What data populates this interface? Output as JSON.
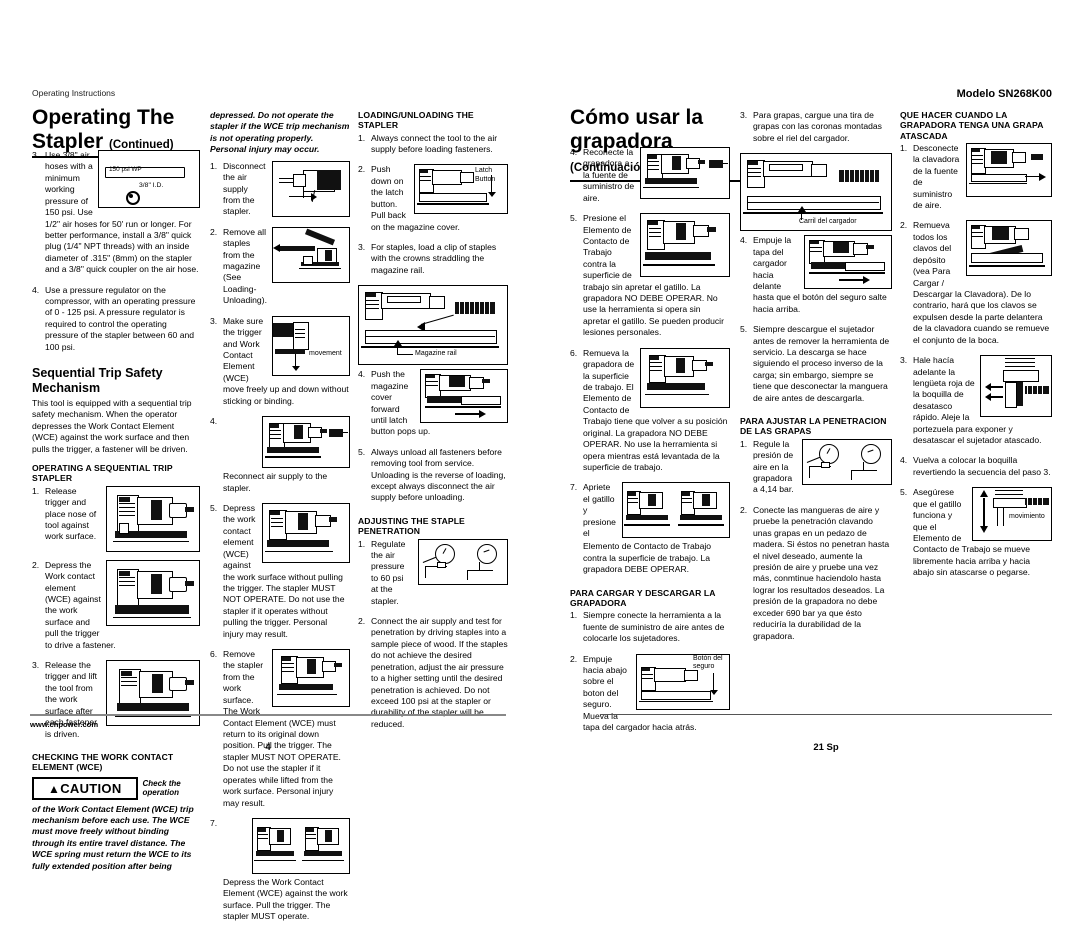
{
  "meta": {
    "header_left": "Operating Instructions",
    "header_right_model": "Modelo SN268K00",
    "footer_url": "www.chpower.com",
    "page_left": "4",
    "page_right": "21 Sp"
  },
  "left_page": {
    "title_main": "Operating The",
    "title_sub": "Stapler",
    "title_cont": "(Continued)",
    "col1": {
      "item3": {
        "num": "3.",
        "text": "Use 3/8\" air hoses with a minimum working pressure of 150 psi. Use 1/2\" air hoses for 50' run or longer. For better performance, install a 3/8\" quick plug (1/4\" NPT threads) with an inside diameter of .315\" (8mm) on the stapler and a 3/8\" quick coupler on the air hose.",
        "fig_label_psi": "150 psi WP",
        "fig_label_id": "3/8\" I.D."
      },
      "item4": {
        "num": "4.",
        "text": "Use a pressure regulator on the compressor, with an operating pressure of 0 - 125 psi. A pressure regulator is required to control the operating pressure of the stapler between 60 and 100 psi."
      },
      "heading_seq": "Sequential Trip Safety Mechanism",
      "seq_body": "This tool is equipped with a sequential trip safety mechanism. When the operator depresses the Work Contact Element (WCE) against the work surface and then pulls the trigger, a fastener will be driven.",
      "heading_op_seq": "OPERATING A SEQUENTIAL TRIP STAPLER",
      "steps": [
        {
          "num": "1.",
          "text": "Release trigger and place nose of tool against work surface."
        },
        {
          "num": "2.",
          "text": "Depress the Work contact element (WCE) against the work surface and pull the trigger to drive a fastener."
        },
        {
          "num": "3.",
          "text": "Release the trigger and lift the tool from the work surface after each fastener is driven."
        }
      ],
      "heading_check": "CHECKING THE WORK CONTACT ELEMENT (WCE)",
      "caution_label": "CAUTION",
      "caution_inline": "Check the operation",
      "caution_body": "of the Work Contact Element (WCE) trip mechanism before each use. The WCE must move freely without binding through its entire travel distance. The WCE spring must return the WCE to its fully extended position after being"
    },
    "col2": {
      "cont_italic": "depressed. Do not operate the stapler if the WCE trip mechanism is not operating properly. Personal injury may occur.",
      "steps": [
        {
          "num": "1.",
          "text": "Disconnect the air supply from the stapler."
        },
        {
          "num": "2.",
          "text": "Remove all staples from the magazine (See Loading-Unloading)."
        },
        {
          "num": "3.",
          "text": "Make sure the trigger and Work Contact Element (WCE) move freely up and down without sticking or binding.",
          "fig_caption": "movement"
        },
        {
          "num": "4.",
          "text": "Reconnect air supply to the stapler."
        },
        {
          "num": "5.",
          "text": "Depress the work contact element (WCE) against the work surface without pulling the trigger. The stapler MUST NOT OPERATE. Do not use the stapler if it operates without pulling the trigger. Personal injury may result."
        },
        {
          "num": "6.",
          "text": "Remove the stapler from the work surface. The Work Contact Element (WCE) must return to its original down position. Pull the trigger. The stapler MUST NOT OPERATE. Do not use the stapler if it operates while lifted from the work surface. Personal injury may result."
        },
        {
          "num": "7.",
          "text": "Depress the Work Contact Element (WCE) against the work surface. Pull the trigger. The stapler MUST operate."
        }
      ]
    },
    "col3": {
      "heading_load": "LOADING/UNLOADING THE STAPLER",
      "steps": [
        {
          "num": "1.",
          "text": "Always connect the tool to the air supply before loading fasteners."
        },
        {
          "num": "2.",
          "text": "Push down on the latch button. Pull back on the magazine cover.",
          "fig_caption": "Latch Button"
        },
        {
          "num": "3.",
          "text": "For staples, load a clip of staples with the crowns straddling the magazine rail.",
          "fig_caption": "Magazine rail"
        },
        {
          "num": "4.",
          "text": "Push the magazine cover forward until latch button pops up."
        },
        {
          "num": "5.",
          "text": "Always unload all fasteners before removing tool from service. Unloading is the reverse of loading, except always disconnect the air supply before unloading."
        }
      ],
      "heading_adjust": "ADJUSTING THE STAPLE PENETRATION",
      "adjust_steps": [
        {
          "num": "1.",
          "text": "Regulate the air pressure to 60 psi at the stapler."
        },
        {
          "num": "2.",
          "text": "Connect the air supply and test for penetration by driving staples into a sample piece of wood. If the staples do not achieve the desired penetration, adjust the air pressure to a higher setting until the desired penetration is achieved. Do not exceed 100 psi at the stapler or durability of the stapler will be reduced."
        }
      ]
    }
  },
  "right_page": {
    "title_main": "Cómo usar la",
    "title_sub": "grapadora",
    "title_cont": "(Continuación)",
    "col1": {
      "steps": [
        {
          "num": "4.",
          "text": "Reconecte la grapadora a la fuente de suministro de aire."
        },
        {
          "num": "5.",
          "text": "Presione el Elemento de Contacto de Trabajo contra la superficie de trabajo sin apretar el gatillo. La grapadora NO DEBE OPERAR. No use la herramienta si opera sin apretar el gatillo. Se pueden producir lesiones personales."
        },
        {
          "num": "6.",
          "text": "Remueva la grapadora de la superficie de trabajo. El Elemento de Contacto de Trabajo tiene que volver a su posición original. La grapadora NO DEBE OPERAR. No use la herramienta si opera mientras está levantada de la superficie de trabajo."
        },
        {
          "num": "7.",
          "text": "Apriete el gatillo y presione el Elemento de Contacto de Trabajo contra la superficie de trabajo. La grapadora DEBE OPERAR."
        }
      ],
      "heading_cargar": "PARA CARGAR Y DESCARGAR LA GRAPADORA",
      "cargar_steps": [
        {
          "num": "1.",
          "text": "Siempre conecte la herramienta a la fuente de suministro de aire antes de colocarle los sujetadores."
        },
        {
          "num": "2.",
          "text": "Empuje hacia abajo sobre el boton del seguro. Mueva la tapa del cargador hacia atrás.",
          "fig_caption": "Botón del seguro"
        }
      ]
    },
    "col2": {
      "steps": [
        {
          "num": "3.",
          "text": "Para grapas, cargue una tira de grapas con las coronas montadas sobre el riel del cargador.",
          "fig_caption": "Carril del cargador"
        },
        {
          "num": "4.",
          "text": "Empuje la tapa del cargador hacia delante hasta que el botón del seguro salte hacia arriba."
        },
        {
          "num": "5.",
          "text": "Siempre descargue el sujetador antes de remover la herramienta de servicio. La descarga se hace siguiendo el proceso inverso de la carga; sin embargo, siempre se tiene que desconectar la manguera de aire antes de descargarla."
        }
      ],
      "heading_ajustar": "PARA AJUSTAR LA PENETRACION DE LAS GRAPAS",
      "ajustar_steps": [
        {
          "num": "1.",
          "text": "Regule la presión de aire en la grapadora a 4,14 bar."
        },
        {
          "num": "2.",
          "text": "Conecte las mangueras de aire y pruebe la penetración clavando unas grapas en un pedazo de madera. Si éstos no penetran hasta el nivel deseado, aumente la presión de aire y pruebe una vez más, conmtinue haciendolo hasta lograr los resultados deseados. La presión de la grapadora no debe exceder 690 bar ya que ésto reduciría la durabilidad de la grapadora."
        }
      ]
    },
    "col3": {
      "heading_atascada": "QUE HACER CUANDO LA GRAPADORA TENGA UNA GRAPA ATASCADA",
      "steps": [
        {
          "num": "1.",
          "text": "Desconecte la clavadora de la fuente de suministro de aire."
        },
        {
          "num": "2.",
          "text": "Remueva todos los clavos del depósito (vea Para Cargar / Descargar la Clavadora). De lo contrario, hará que los clavos se expulsen desde la parte delantera de la clavadora cuando se remueve el conjunto de la boca."
        },
        {
          "num": "3.",
          "text": "Hale hacía adelante la lengüeta roja de la boquilla de desatasco rápido. Aleje la portezuela para exponer y desatascar el sujetador atascado."
        },
        {
          "num": "4.",
          "text": "Vuelva a colocar la boquilla revertiendo la secuencia del paso 3."
        },
        {
          "num": "5.",
          "text": "Asegúrese que el gatillo funciona y que el Elemento de Contacto de Trabajo se mueve libremente hacia arriba y hacia abajo sin atascarse o pegarse.",
          "fig_caption": "movimiento"
        }
      ]
    }
  }
}
